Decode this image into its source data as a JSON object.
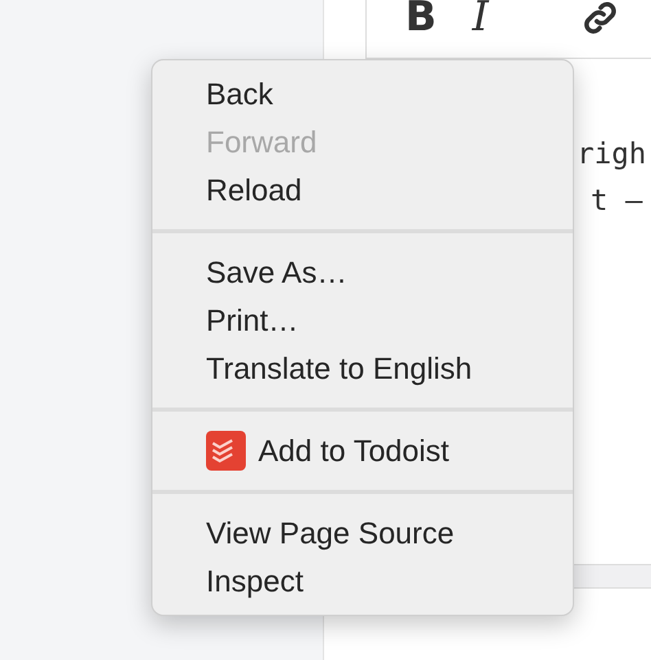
{
  "toolbar": {
    "buttons": [
      {
        "label": "B",
        "kind": "bold"
      },
      {
        "label": "I",
        "kind": "italic"
      },
      {
        "kind": "link"
      }
    ]
  },
  "editor": {
    "lines": [
      "righ",
      "t –"
    ]
  },
  "context_menu": {
    "groups": [
      {
        "items": [
          {
            "label": "Back",
            "disabled": false
          },
          {
            "label": "Forward",
            "disabled": true
          },
          {
            "label": "Reload",
            "disabled": false
          }
        ]
      },
      {
        "items": [
          {
            "label": "Save As…",
            "disabled": false
          },
          {
            "label": "Print…",
            "disabled": false
          },
          {
            "label": "Translate to English",
            "disabled": false
          }
        ]
      },
      {
        "items": [
          {
            "label": "Add to Todoist",
            "disabled": false,
            "kind": "icon_item"
          }
        ]
      },
      {
        "items": [
          {
            "label": "View Page Source",
            "disabled": false
          },
          {
            "label": "Inspect",
            "disabled": false
          }
        ]
      }
    ]
  }
}
